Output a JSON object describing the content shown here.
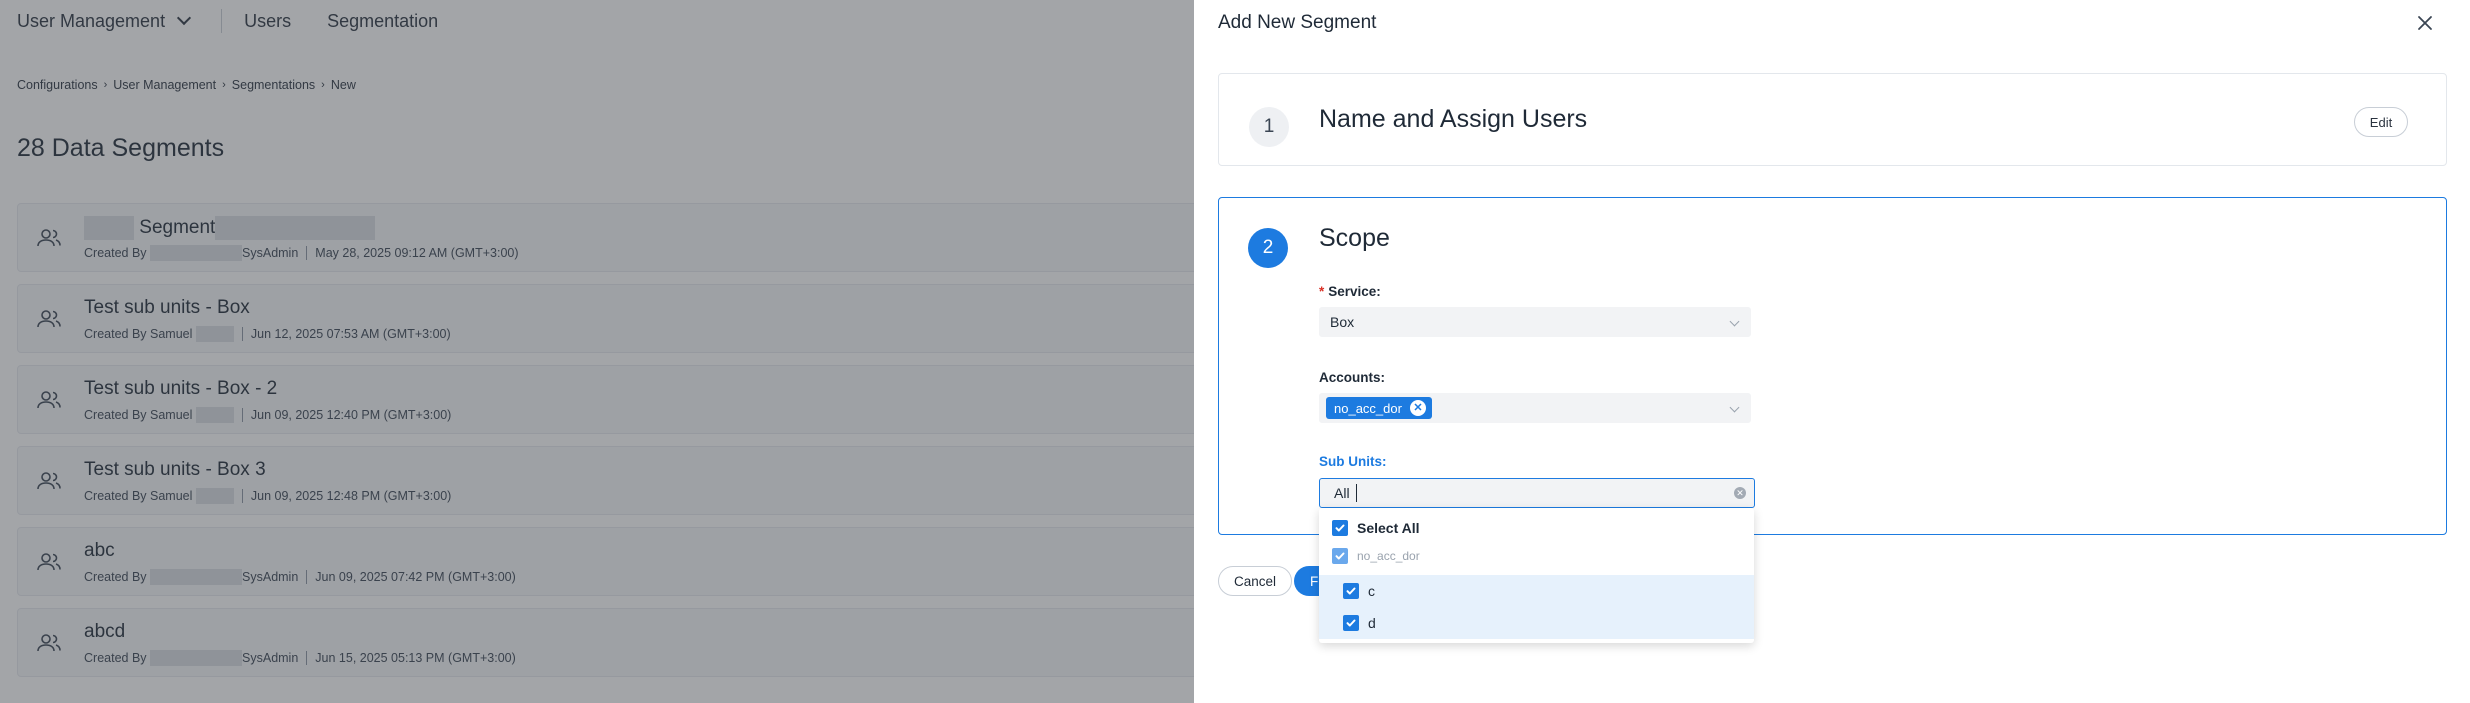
{
  "topnav": {
    "module": "User Management",
    "tabs": [
      "Users",
      "Segmentation"
    ]
  },
  "breadcrumb": [
    "Configurations",
    "User Management",
    "Segmentations",
    "New"
  ],
  "page_title": "28 Data Segments",
  "segments": [
    {
      "name": "Segment",
      "created_by": "Created By",
      "creator": "SysAdmin",
      "date": "May 28, 2025 09:12 AM (GMT+3:00)"
    },
    {
      "name": "Test sub units - Box",
      "created_by": "Created By Samuel",
      "creator": "",
      "date": "Jun 12, 2025 07:53 AM (GMT+3:00)"
    },
    {
      "name": "Test sub units - Box - 2",
      "created_by": "Created By Samuel",
      "creator": "",
      "date": "Jun 09, 2025 12:40 PM (GMT+3:00)"
    },
    {
      "name": "Test sub units - Box 3",
      "created_by": "Created By Samuel",
      "creator": "",
      "date": "Jun 09, 2025 12:48 PM (GMT+3:00)"
    },
    {
      "name": "abc",
      "created_by": "Created By",
      "creator": "SysAdmin",
      "date": "Jun 09, 2025 07:42 PM (GMT+3:00)"
    },
    {
      "name": "abcd",
      "created_by": "Created By",
      "creator": "SysAdmin",
      "date": "Jun 15, 2025 05:13 PM (GMT+3:00)"
    }
  ],
  "drawer": {
    "title": "Add New Segment",
    "step1": {
      "number": "1",
      "title": "Name and Assign Users",
      "edit_label": "Edit"
    },
    "step2": {
      "number": "2",
      "title": "Scope",
      "service_label": "Service:",
      "service_required": "*",
      "service_value": "Box",
      "accounts_label": "Accounts:",
      "account_tag": "no_acc_dor",
      "subunits_label": "Sub Units:",
      "subunits_value": "All"
    },
    "cancel_label": "Cancel",
    "primary_label": "F"
  },
  "dropdown": {
    "select_all": "Select All",
    "group": "no_acc_dor",
    "options": [
      "c",
      "d"
    ]
  },
  "colors": {
    "accent": "#1d7be0",
    "highlight": "#e6f1fc",
    "overlay": "rgba(60,64,70,0.47)"
  }
}
